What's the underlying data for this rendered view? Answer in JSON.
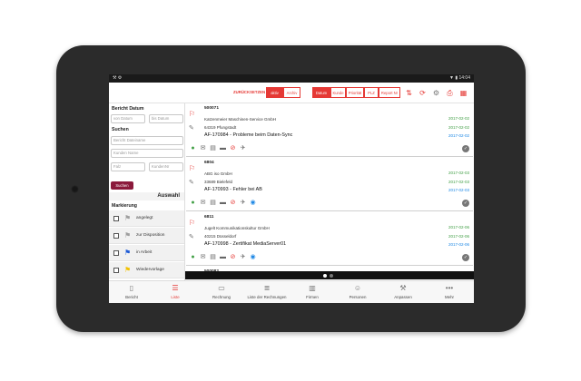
{
  "statusbar": {
    "left": "⚒ ⚙",
    "right": "▼ ▮ 14:04"
  },
  "toolbar": {
    "reset_label": "ZURÜCKSETZEN",
    "filter_tabs": [
      {
        "label": "aktiv",
        "active": true
      },
      {
        "label": "Archiv",
        "active": false
      }
    ],
    "sort_tabs": [
      {
        "label": "Datum",
        "active": true
      },
      {
        "label": "Kunde",
        "active": false
      },
      {
        "label": "Priorität",
        "active": false
      },
      {
        "label": "PLZ",
        "active": false
      },
      {
        "label": "Report Nr",
        "active": false
      }
    ],
    "icons": [
      "sort-order-icon",
      "refresh-icon",
      "settings-icon",
      "print-icon",
      "calendar-icon"
    ]
  },
  "sidebar": {
    "report_date_title": "Bericht Datum",
    "from_date_placeholder": "von Datum",
    "to_date_placeholder": "bis Datum",
    "search_title": "Suchen",
    "report_name_placeholder": "Bericht Dateiname",
    "customer_name_placeholder": "Kunden Name",
    "plz_placeholder": "Falz",
    "customer_nr_placeholder": "KundenNr",
    "search_button": "Suchen",
    "auswahl_title": "Auswahl",
    "marking_title": "Markierung",
    "markings": [
      {
        "label": "angelegt",
        "color": "#9e9e9e"
      },
      {
        "label": "zur Disposition",
        "color": "#9e9e9e"
      },
      {
        "label": "in Arbeit",
        "color": "#1e5bd6"
      },
      {
        "label": "Wiedervorlage",
        "color": "#f2c200"
      }
    ]
  },
  "list": {
    "cards": [
      {
        "number": "500071",
        "company": "Katzenmeier Maschinen-Service GmbH",
        "address": "64319 Pfungstadt",
        "title": "AF-170984 - Probleme beim Daten-Sync",
        "date1": "2017-02-02",
        "date2": "2017-02-02",
        "date3": "2017-02-02"
      },
      {
        "number": "6804",
        "company": "ABG iso GmbH",
        "address": "33689 Bielefeld",
        "title": "AF-170993 - Fehler bei AB",
        "date1": "2017-02-03",
        "date2": "2017-02-03",
        "date3": "2017-02-03"
      },
      {
        "number": "6811",
        "company": "Jugelt Kommunikationskultur GmbH",
        "address": "40215 Düsseldorf",
        "title": "AF-170998 - Zertifikat MediaServer01",
        "date1": "2017-02-06",
        "date2": "2017-02-06",
        "date3": "2017-02-06"
      },
      {
        "number": "500082",
        "company": "",
        "address": "",
        "title": "",
        "date1": "",
        "date2": "",
        "date3": ""
      }
    ]
  },
  "nav": {
    "items": [
      {
        "label": "Bericht",
        "icon": "document-icon",
        "active": false
      },
      {
        "label": "Liste",
        "icon": "list-icon",
        "active": true
      },
      {
        "label": "Rechnung",
        "icon": "invoice-icon",
        "active": false
      },
      {
        "label": "Liste der Rechnungen",
        "icon": "invoice-list-icon",
        "active": false
      },
      {
        "label": "Firmen",
        "icon": "company-icon",
        "active": false
      },
      {
        "label": "Personen",
        "icon": "person-icon",
        "active": false
      },
      {
        "label": "Anpassen",
        "icon": "customize-icon",
        "active": false
      },
      {
        "label": "Mehr",
        "icon": "more-icon",
        "active": false
      }
    ]
  },
  "colors": {
    "accent": "#e53935",
    "search_button": "#8b1a3c",
    "date_green": "#43a047",
    "date_blue": "#1e88e5"
  }
}
